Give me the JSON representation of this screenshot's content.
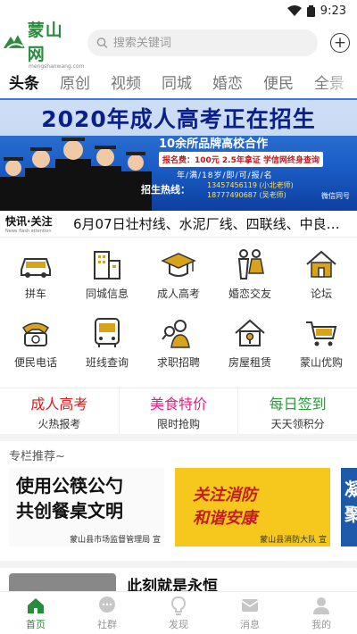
{
  "status": {
    "time": "9:23"
  },
  "header": {
    "logo_text": "蒙山网",
    "logo_sub": "mengshanwang.com",
    "search_placeholder": "搜索关键词"
  },
  "tabs": [
    "头条",
    "原创",
    "视频",
    "同城",
    "婚恋",
    "便民",
    "全景"
  ],
  "banner": {
    "title": "2020年成人高考正在招生",
    "subtitle": "10余所品牌高校合作",
    "fee": "报名费：100元  2.5年拿证  学信网终身查询",
    "requirement": "年/满/18岁/即/可/报/名",
    "hotline_label": "招生热线：",
    "phone1": "13457456119 (小北老师)",
    "phone2": "18777490687 (吴老师)",
    "wechat": "微信同号"
  },
  "news": {
    "label": "快讯·关注",
    "label_sub": "News flash attention",
    "text": "6月07日壮村线、水泥厂线、四联线、中良…"
  },
  "services": [
    {
      "label": "拼车",
      "icon": "carpool-icon"
    },
    {
      "label": "同城信息",
      "icon": "city-building-icon"
    },
    {
      "label": "成人高考",
      "icon": "graduation-cap-icon"
    },
    {
      "label": "婚恋交友",
      "icon": "couple-icon"
    },
    {
      "label": "论坛",
      "icon": "house-forum-icon"
    },
    {
      "label": "便民电话",
      "icon": "telephone-icon"
    },
    {
      "label": "班线查询",
      "icon": "bus-icon"
    },
    {
      "label": "求职招聘",
      "icon": "job-search-icon"
    },
    {
      "label": "房屋租赁",
      "icon": "house-key-icon"
    },
    {
      "label": "蒙山优购",
      "icon": "shopping-cart-icon"
    }
  ],
  "promos": [
    {
      "title": "成人高考",
      "sub": "火热报考",
      "color": "#d21c1c"
    },
    {
      "title": "美食特价",
      "sub": "限时抢购",
      "color": "#e0218a"
    },
    {
      "title": "每日签到",
      "sub": "天天领积分",
      "color": "#2a9a3a"
    }
  ],
  "section": {
    "title": "专栏推荐~"
  },
  "cards": [
    {
      "line1": "使用公筷公勺",
      "line2": "共创餐桌文明",
      "foot": "蒙山县市场监督管理局 宣"
    },
    {
      "line1": "关注消防",
      "line2": "和谐安康",
      "foot": "蒙山县消防大队 宣"
    },
    {
      "line1": "凝",
      "line2": "聚"
    }
  ],
  "article": {
    "title": "此刻就是永恒"
  },
  "bottom_nav": [
    {
      "label": "首页",
      "icon": "home-icon"
    },
    {
      "label": "社群",
      "icon": "chat-bubble-icon"
    },
    {
      "label": "发现",
      "icon": "lightbulb-icon"
    },
    {
      "label": "消息",
      "icon": "message-icon"
    },
    {
      "label": "我的",
      "icon": "profile-icon"
    }
  ],
  "colors": {
    "brand": "#2a8a3e",
    "icon_gold": "#d9a21b"
  }
}
